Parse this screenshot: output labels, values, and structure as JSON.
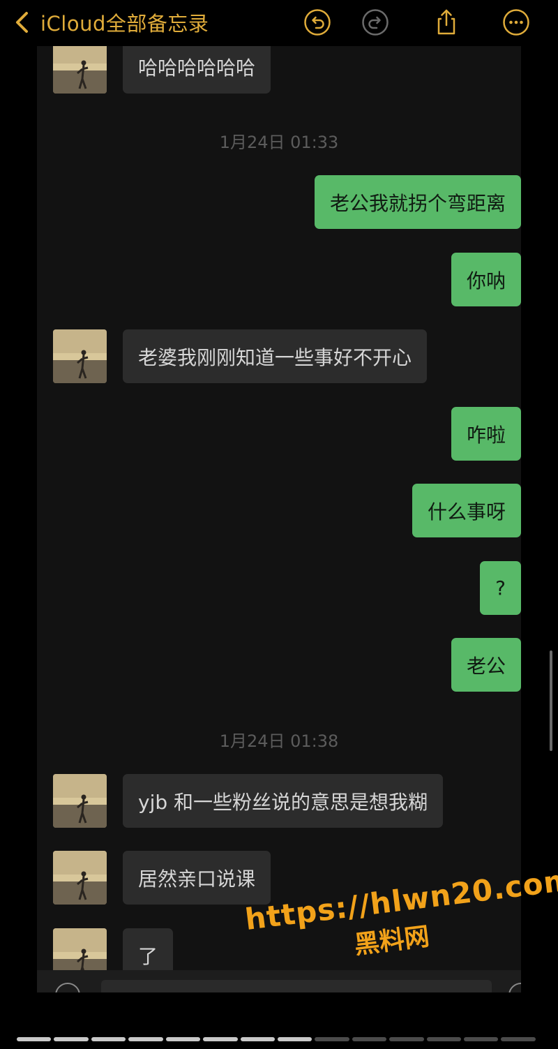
{
  "navbar": {
    "back_label": "iCloud全部备忘录",
    "accent": "#e0ac3a",
    "icons": [
      "chevron-left-icon",
      "undo-icon",
      "redo-icon",
      "share-icon",
      "more-icon"
    ]
  },
  "chat": {
    "colors": {
      "incoming_bubble": "#2c2c2c",
      "outgoing_bubble": "#58b968",
      "background": "#121212"
    },
    "messages": [
      {
        "type": "in",
        "text": "哈哈哈哈哈哈"
      },
      {
        "type": "time",
        "text": "1月24日 01:33"
      },
      {
        "type": "out",
        "text": "老公我就拐个弯距离"
      },
      {
        "type": "out",
        "text": "你呐"
      },
      {
        "type": "in",
        "text": "老婆我刚刚知道一些事好不开心"
      },
      {
        "type": "out",
        "text": "咋啦"
      },
      {
        "type": "out",
        "text": "什么事呀"
      },
      {
        "type": "out",
        "text": "?"
      },
      {
        "type": "out",
        "text": "老公"
      },
      {
        "type": "time",
        "text": "1月24日 01:38"
      },
      {
        "type": "in",
        "text": "yjb 和一些粉丝说的意思是想我糊"
      },
      {
        "type": "in",
        "text": "居然亲口说课"
      },
      {
        "type": "in",
        "text": "了"
      }
    ]
  },
  "watermark": {
    "url": "https://hlwn20.com",
    "name": "黑料网",
    "color": "#f2a21a"
  },
  "pager": {
    "total_segments": 14,
    "completed_segments": 8
  }
}
